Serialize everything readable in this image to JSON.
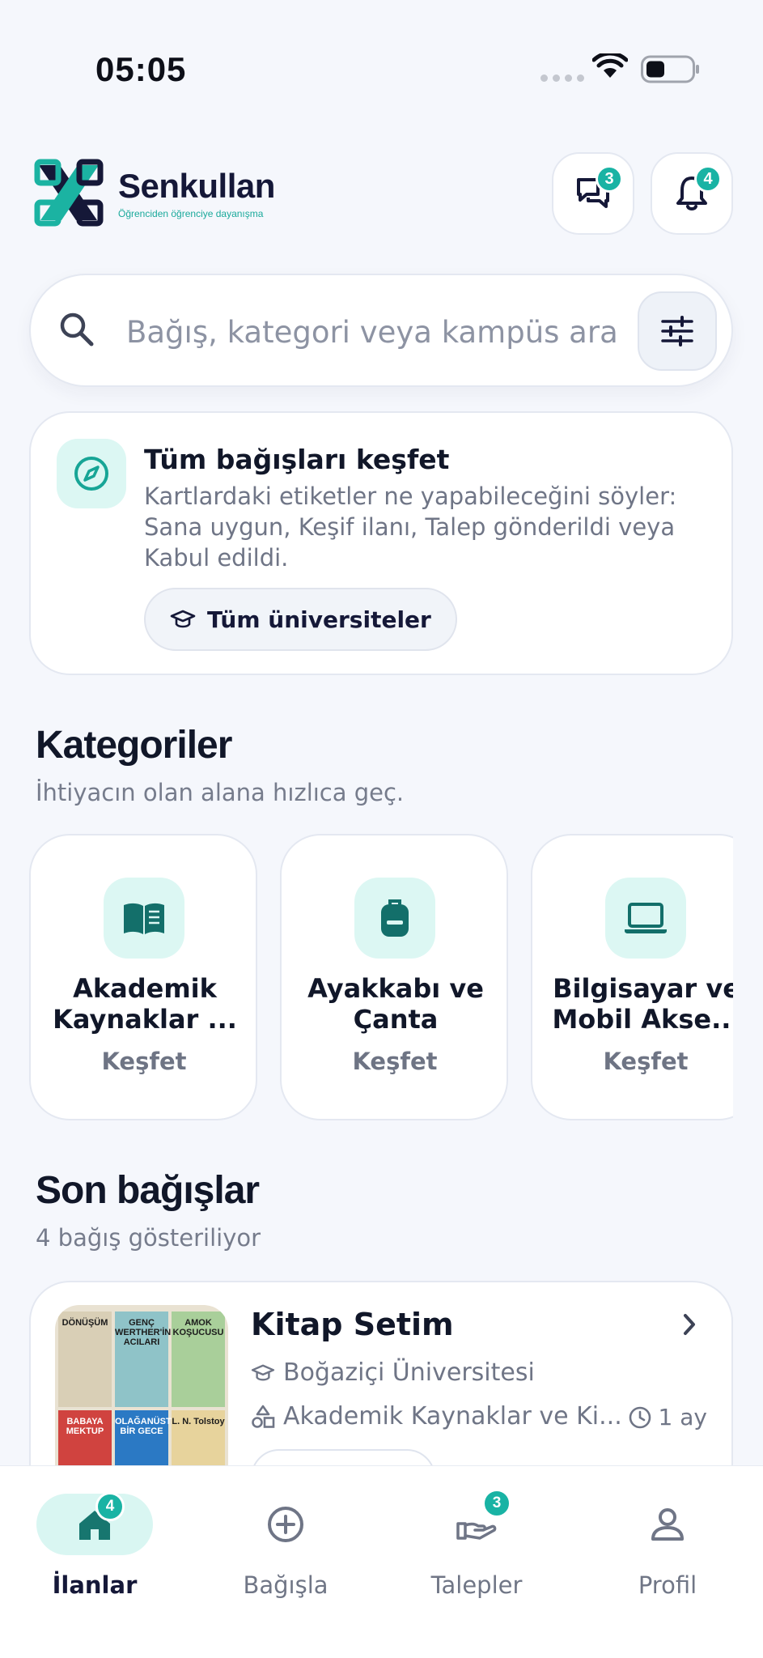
{
  "status_bar": {
    "time": "05:05"
  },
  "header": {
    "brand": "Senkullan",
    "tagline": "Öğrenciden öğrenciye dayanışma",
    "messages_badge": "3",
    "notifications_badge": "4"
  },
  "search": {
    "placeholder": "Bağış, kategori veya kampüs ara"
  },
  "explore": {
    "title": "Tüm bağışları keşfet",
    "description": "Kartlardaki etiketler ne yapabileceğini söyler: Sana uygun, Keşif ilanı, Talep gönderildi veya Kabul edildi.",
    "chip_label": "Tüm üniversiteler"
  },
  "categories": {
    "title": "Kategoriler",
    "subtitle": "İhtiyacın olan alana hızlıca geç.",
    "items": [
      {
        "name": "Akademik\nKaynaklar ...",
        "action": "Keşfet",
        "icon": "book-icon"
      },
      {
        "name": "Ayakkabı ve\nÇanta",
        "action": "Keşfet",
        "icon": "backpack-icon"
      },
      {
        "name": "Bilgisayar ve\nMobil Akse...",
        "action": "Keşfet",
        "icon": "laptop-icon"
      }
    ]
  },
  "recent": {
    "title": "Son bağışlar",
    "subtitle": "4 bağış gösteriliyor",
    "items": [
      {
        "title": "Kitap Setim",
        "university": "Boğaziçi Üniversitesi",
        "category": "Akademik Kaynaklar ve Ki...",
        "time": "1 ay",
        "thumbnail_books": [
          "DÖNÜŞÜM",
          "GENÇ WERTHER'İN ACILARI",
          "AMOK KOŞUCUSU",
          "BABAYA MEKTUP",
          "OLAĞANÜSTÜ BİR GECE",
          "L. N. Tolstoy"
        ]
      }
    ]
  },
  "tabbar": {
    "items": [
      {
        "label": "İlanlar",
        "badge": "4",
        "icon": "home-icon",
        "active": true
      },
      {
        "label": "Bağışla",
        "badge": "",
        "icon": "plus-circle-icon",
        "active": false
      },
      {
        "label": "Talepler",
        "badge": "3",
        "icon": "hand-icon",
        "active": false
      },
      {
        "label": "Profil",
        "badge": "",
        "icon": "user-icon",
        "active": false
      }
    ]
  },
  "colors": {
    "accent": "#19b3a4",
    "accent_soft": "#dcf7f3",
    "brand_navy": "#151838",
    "background": "#f5f7fc"
  }
}
